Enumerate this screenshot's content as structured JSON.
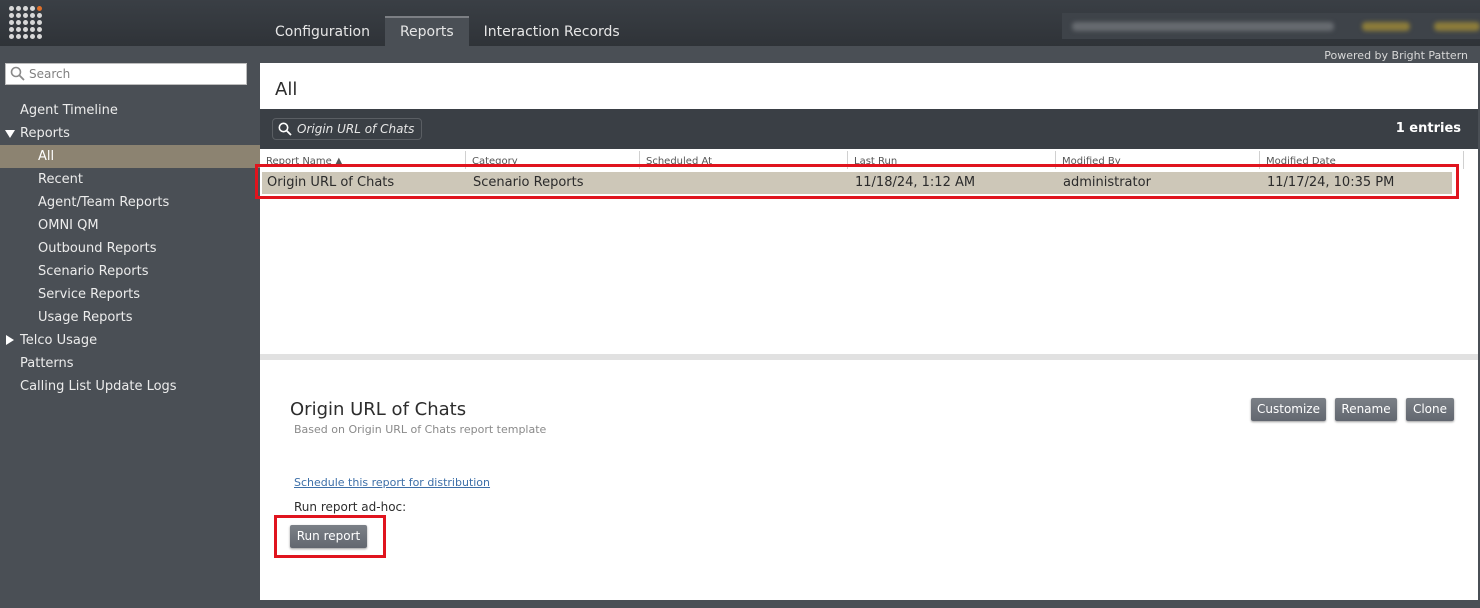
{
  "topnav": {
    "tabs": [
      {
        "label": "Configuration"
      },
      {
        "label": "Reports"
      },
      {
        "label": "Interaction Records"
      }
    ],
    "powered_by": "Powered by Bright Pattern"
  },
  "sidebar": {
    "search_placeholder": "Search",
    "items": [
      {
        "label": "Agent Timeline"
      },
      {
        "label": "Reports"
      },
      {
        "label": "All"
      },
      {
        "label": "Recent"
      },
      {
        "label": "Agent/Team Reports"
      },
      {
        "label": "OMNI QM"
      },
      {
        "label": "Outbound Reports"
      },
      {
        "label": "Scenario Reports"
      },
      {
        "label": "Service Reports"
      },
      {
        "label": "Usage Reports"
      },
      {
        "label": "Telco Usage"
      },
      {
        "label": "Patterns"
      },
      {
        "label": "Calling List Update Logs"
      }
    ]
  },
  "main": {
    "title": "All",
    "filter_text": "Origin URL of Chats",
    "entries": "1 entries",
    "columns": [
      "Report Name ▲",
      "Category",
      "Scheduled At",
      "Last Run",
      "Modified By",
      "Modified Date"
    ],
    "rows": [
      [
        "Origin URL of Chats",
        "Scenario Reports",
        "",
        "11/18/24, 1:12 AM",
        "administrator",
        "11/17/24, 10:35 PM"
      ]
    ]
  },
  "detail": {
    "title": "Origin URL of Chats",
    "subtitle": "Based on Origin URL of Chats report template",
    "customize": "Customize",
    "rename": "Rename",
    "clone": "Clone",
    "schedule_link": "Schedule this report for distribution",
    "adhoc_label": "Run report ad-hoc:",
    "run_button": "Run report"
  },
  "colors": {
    "selected_row": "#cdc7b8",
    "sidebar_selected": "#8c8371",
    "highlight_box": "#e0141e"
  }
}
